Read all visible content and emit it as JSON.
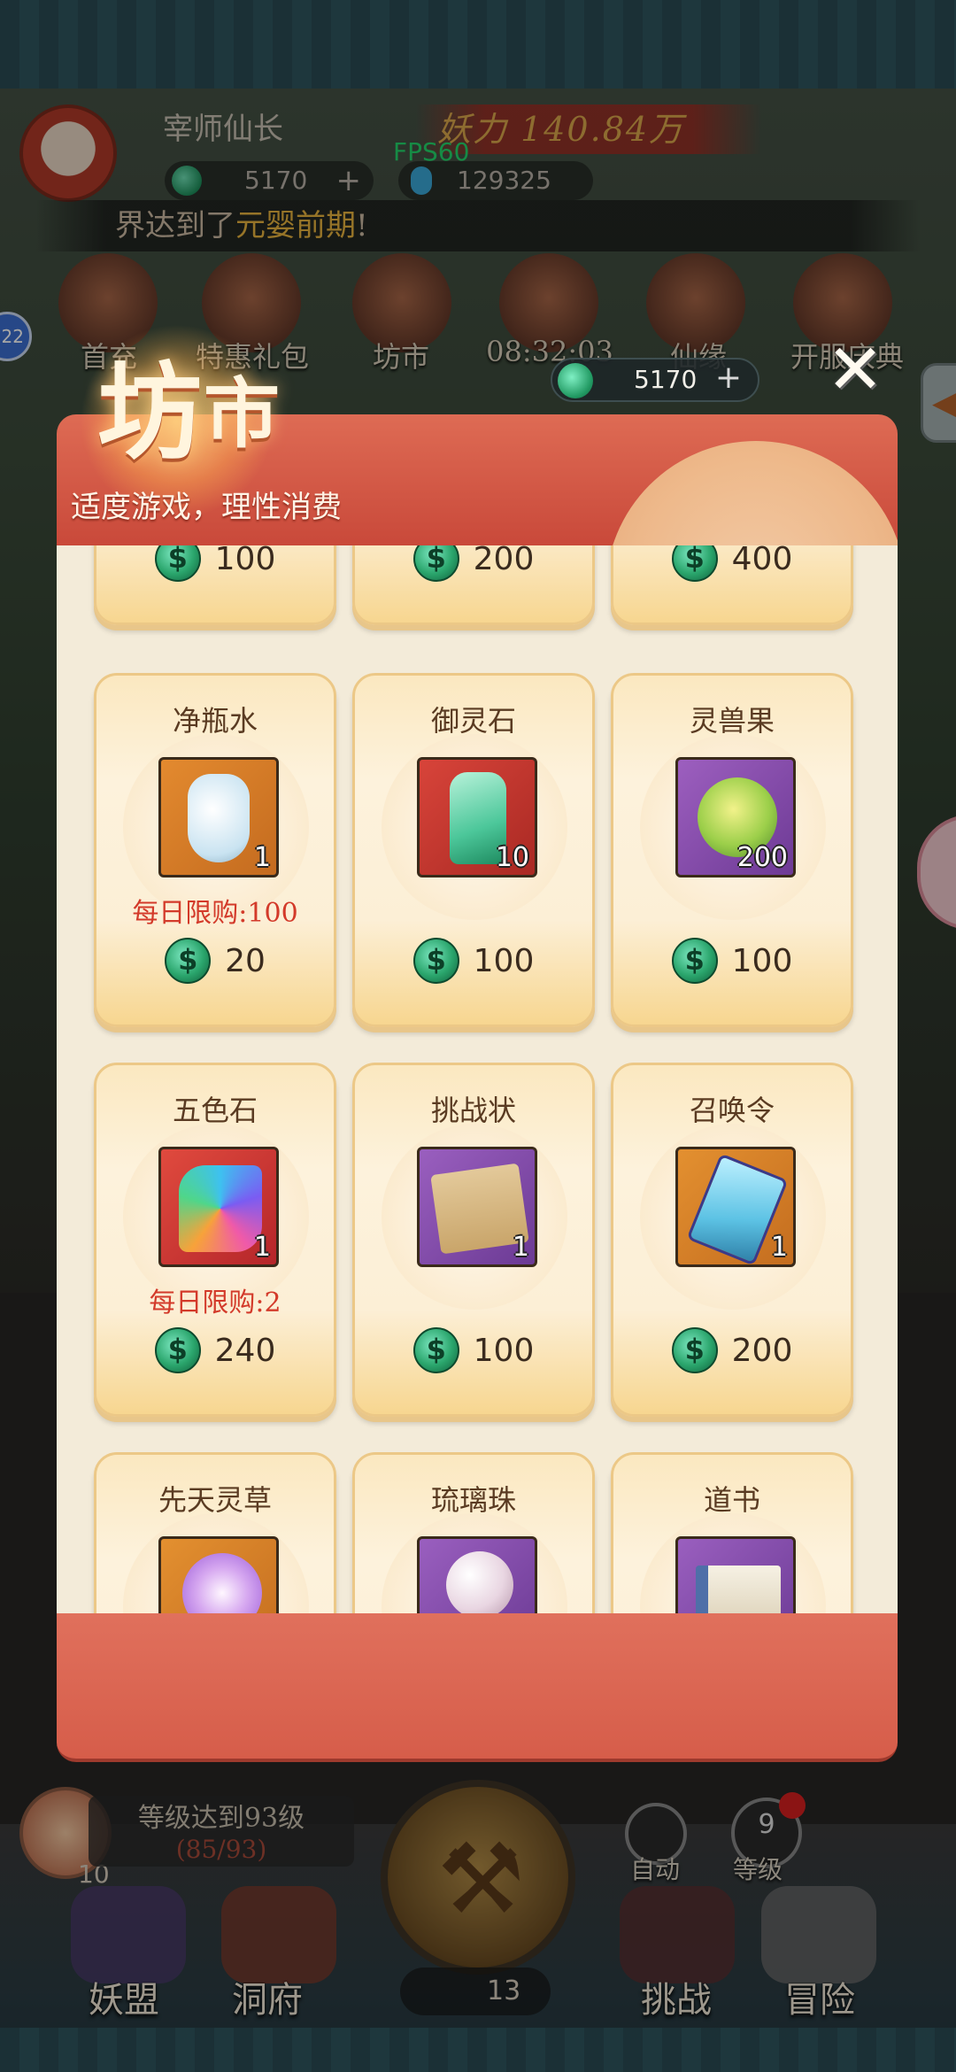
{
  "hud": {
    "player_name": "宰师仙长",
    "power_text": "妖力 140.84万",
    "fps": "FPS60",
    "jade": "5170",
    "gem": "129325",
    "marquee_prefix": "界达到了",
    "marquee_highlight": "元婴前期",
    "marquee_suffix": "!",
    "menu": [
      "首充",
      "特惠礼包",
      "坊市",
      "08:32:03",
      "仙缘",
      "开服庆典"
    ],
    "left_badge": "22"
  },
  "shop": {
    "title_first": "坊",
    "title_second": "市",
    "subtitle": "适度游戏，理性消费",
    "balance": "5170",
    "close_glyph": "✕",
    "partial_top_prices": [
      "100",
      "200",
      "400"
    ],
    "items": [
      {
        "name": "净瓶水",
        "qty": "1",
        "limit": "每日限购:100",
        "price": "20",
        "icon": "water-bottle-icon"
      },
      {
        "name": "御灵石",
        "qty": "10",
        "limit": "",
        "price": "100",
        "icon": "spirit-stone-icon"
      },
      {
        "name": "灵兽果",
        "qty": "200",
        "limit": "",
        "price": "100",
        "icon": "beast-fruit-icon"
      },
      {
        "name": "五色石",
        "qty": "1",
        "limit": "每日限购:2",
        "price": "240",
        "icon": "five-color-stone-icon"
      },
      {
        "name": "挑战状",
        "qty": "1",
        "limit": "",
        "price": "100",
        "icon": "challenge-scroll-icon"
      },
      {
        "name": "召唤令",
        "qty": "1",
        "limit": "",
        "price": "200",
        "icon": "summon-token-icon"
      },
      {
        "name": "先天灵草",
        "qty": "",
        "limit": "",
        "price": "",
        "icon": "spirit-herb-icon"
      },
      {
        "name": "琉璃珠",
        "qty": "",
        "limit": "",
        "price": "",
        "icon": "glass-pearl-icon"
      },
      {
        "name": "道书",
        "qty": "",
        "limit": "",
        "price": "",
        "icon": "dao-book-icon"
      }
    ]
  },
  "bottom": {
    "level_goal": "等级达到93级",
    "level_progress": "(85/93)",
    "peach_count": "10",
    "auto_label": "自动",
    "level_btn_value": "9",
    "level_btn_label": "等级",
    "stamina": "13",
    "nav": [
      "妖盟",
      "洞府",
      "挑战",
      "冒险"
    ]
  },
  "colors": {
    "accent_red": "#d65d4a",
    "jade_green": "#2aa56c",
    "limit_red": "#d33a2a",
    "card_gold": "#f7d690"
  }
}
